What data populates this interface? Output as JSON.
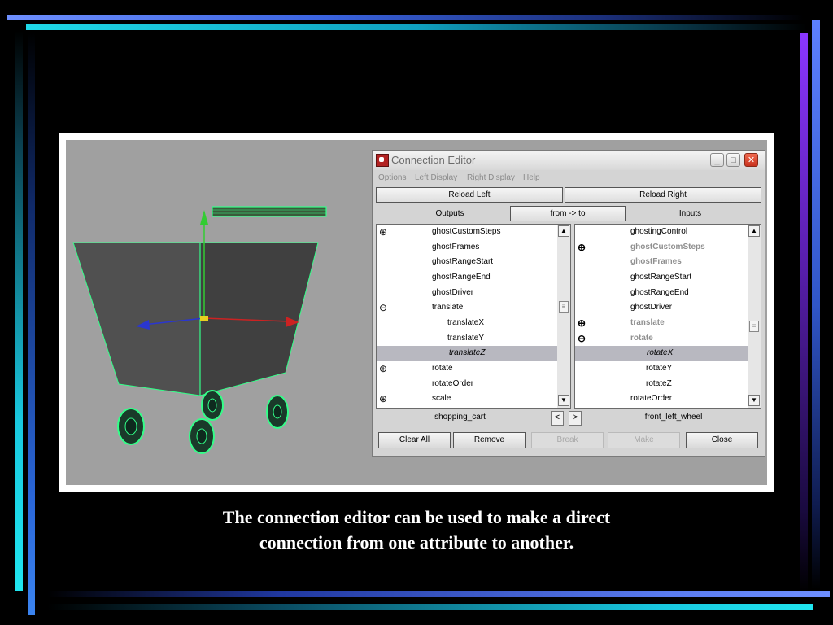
{
  "dialog": {
    "title": "Connection Editor",
    "menu": [
      "Options",
      "Left Display",
      "Right Display",
      "Help"
    ],
    "reload_left": "Reload Left",
    "reload_right": "Reload Right",
    "outputs_label": "Outputs",
    "direction": "from -> to",
    "inputs_label": "Inputs",
    "left_list": [
      {
        "label": "ghostCustomSteps",
        "expander": "⊕"
      },
      {
        "label": "ghostFrames",
        "expander": ""
      },
      {
        "label": "ghostRangeStart",
        "expander": ""
      },
      {
        "label": "ghostRangeEnd",
        "expander": ""
      },
      {
        "label": "ghostDriver",
        "expander": ""
      },
      {
        "label": "translate",
        "expander": "⊖"
      },
      {
        "label": "translateX",
        "expander": ""
      },
      {
        "label": "translateY",
        "expander": ""
      },
      {
        "label": "translateZ",
        "expander": ""
      },
      {
        "label": "rotate",
        "expander": "⊕"
      },
      {
        "label": "rotateOrder",
        "expander": ""
      },
      {
        "label": "scale",
        "expander": "⊕"
      }
    ],
    "right_list": [
      {
        "label": "ghostingControl",
        "expander": ""
      },
      {
        "label": "ghostCustomSteps",
        "expander": "⊕"
      },
      {
        "label": "ghostFrames",
        "expander": ""
      },
      {
        "label": "ghostRangeStart",
        "expander": ""
      },
      {
        "label": "ghostRangeEnd",
        "expander": ""
      },
      {
        "label": "ghostDriver",
        "expander": ""
      },
      {
        "label": "translate",
        "expander": "⊕"
      },
      {
        "label": "rotate",
        "expander": "⊖"
      },
      {
        "label": "rotateX",
        "expander": ""
      },
      {
        "label": "rotateY",
        "expander": ""
      },
      {
        "label": "rotateZ",
        "expander": ""
      },
      {
        "label": "rotateOrder",
        "expander": ""
      }
    ],
    "left_node": "shopping_cart",
    "right_node": "front_left_wheel",
    "nav_prev": "<",
    "nav_next": ">",
    "buttons": {
      "clear_all": "Clear All",
      "remove": "Remove",
      "break": "Break",
      "make": "Make",
      "close": "Close"
    },
    "win_minimize": "_",
    "win_maximize": "□",
    "win_close": "✕"
  },
  "caption_line1": "The connection editor can be used to make a direct",
  "caption_line2": "connection from one attribute to another."
}
